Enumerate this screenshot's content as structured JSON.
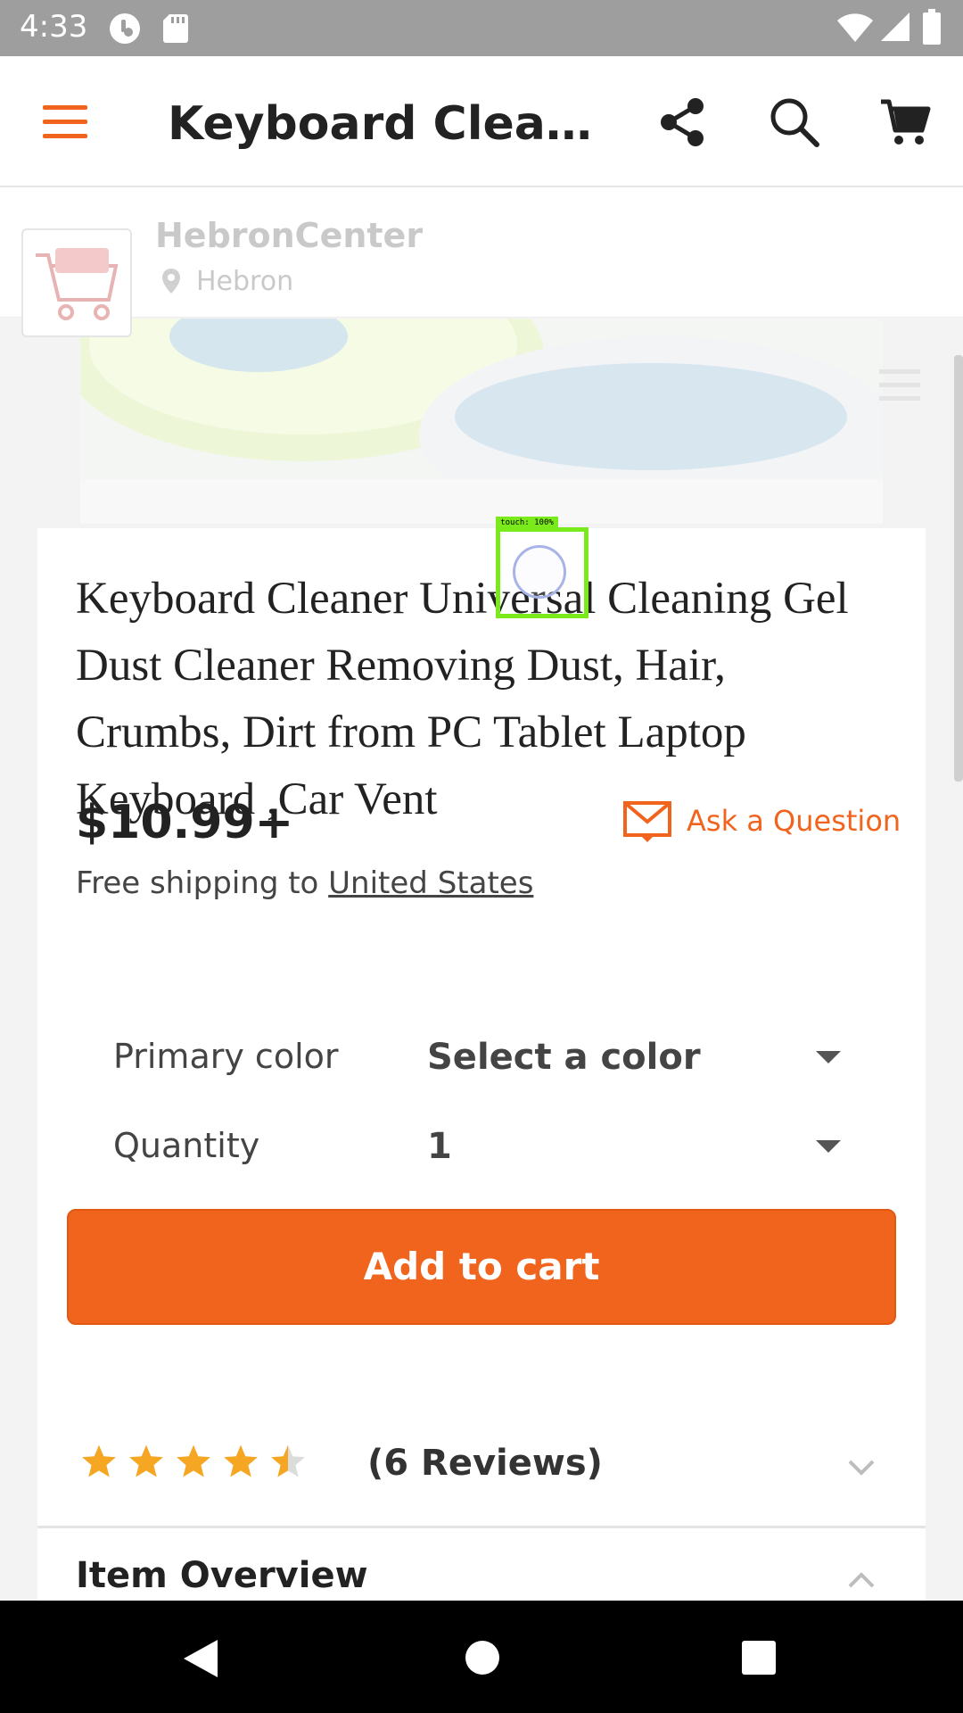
{
  "status_bar": {
    "time": "4:33",
    "icons": [
      "notification-icon",
      "sd-card-icon",
      "wifi-icon",
      "signal-icon",
      "battery-icon"
    ]
  },
  "app_bar": {
    "title": "Keyboard Cleane...",
    "icons": [
      "menu-icon",
      "share-icon",
      "search-icon",
      "cart-icon"
    ]
  },
  "shop": {
    "name": "HebronCenter",
    "location": "Hebron"
  },
  "product": {
    "title": "Keyboard Cleaner Universal Cleaning Gel Dust Cleaner Removing Dust, Hair, Crumbs, Dirt from PC Tablet Laptop Keyboard ,Car Vent",
    "price": "$10.99+",
    "ask_label": "Ask a Question",
    "shipping_prefix": "Free shipping to",
    "shipping_country": "United States"
  },
  "options": {
    "color_label": "Primary color",
    "color_value": "Select a color",
    "quantity_label": "Quantity",
    "quantity_value": "1"
  },
  "cart_button": "Add to cart",
  "reviews": {
    "rating": 4.5,
    "rating_max": 5,
    "count_label": "(6 Reviews)"
  },
  "overview": {
    "title": "Item Overview"
  },
  "touch_overlay": {
    "label": "touch: 100%"
  },
  "colors": {
    "accent": "#f1641e",
    "star": "#f5a623",
    "touch": "#7bea1a"
  }
}
